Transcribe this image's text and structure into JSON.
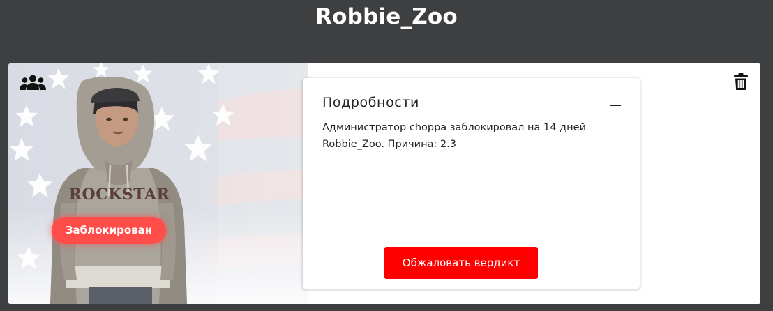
{
  "header": {
    "title": "Robbie_Zoo"
  },
  "profile": {
    "status_badge": "Заблокирован",
    "shirt_text": "ROCKSTAR",
    "accent_color": "#ff4d4a"
  },
  "details": {
    "title": "Подробности",
    "text": "Администратор choppa заблокировал на 14 дней Robbie_Zoo. Причина: 2.3",
    "appeal_button_label": "Обжаловать вердикт",
    "button_color": "#ff0000"
  },
  "icons": {
    "group": "users-icon",
    "delete": "trash-icon",
    "collapse": "minus-icon"
  }
}
